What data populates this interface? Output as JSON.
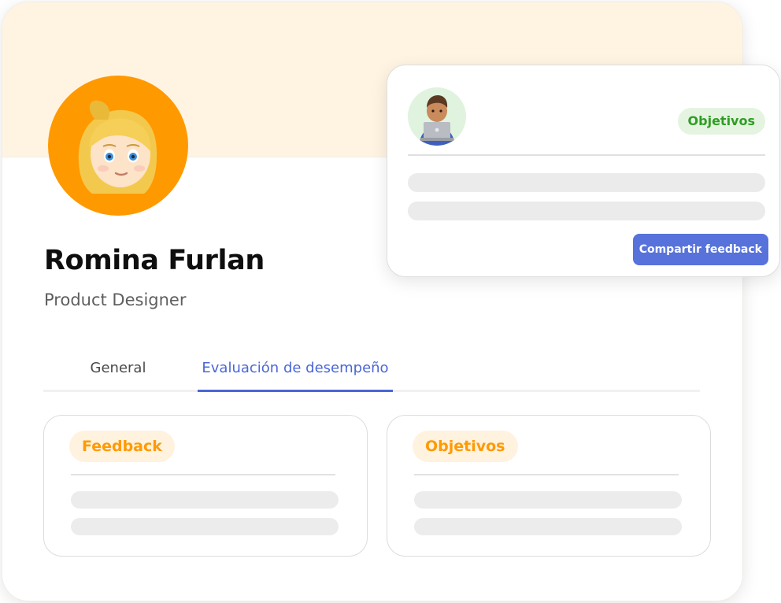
{
  "profile": {
    "name": "Romina Furlan",
    "role": "Product Designer",
    "avatar_icon": "blonde-woman-emoji-icon",
    "avatar_bg": "#ff9900",
    "cover_color": "#fff4e2"
  },
  "tabs": [
    {
      "label": "General",
      "active": false
    },
    {
      "label": "Evaluación de desempeño",
      "active": true
    }
  ],
  "accent": "#4a67d6",
  "panels": {
    "feedback": {
      "chip": "Feedback",
      "chip_color": "#ff9a00"
    },
    "objetivos": {
      "chip": "Objetivos",
      "chip_color": "#ff9a00"
    }
  },
  "feedback_card": {
    "avatar_icon": "man-with-laptop-emoji-icon",
    "chip": "Objetivos",
    "chip_color": "#2f9e23",
    "button_label": "Compartir feedback",
    "button_color": "#5772db"
  }
}
